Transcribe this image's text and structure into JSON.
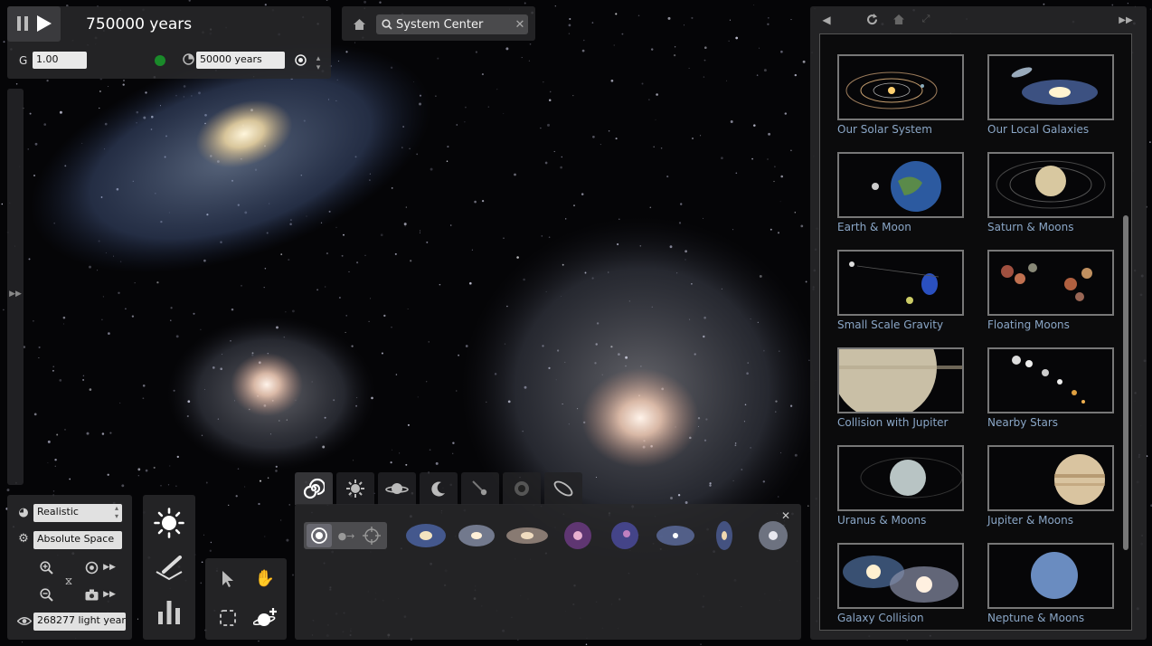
{
  "time": {
    "elapsed": "750000 years",
    "gravity_label": "G",
    "gravity_value": "1.00",
    "step_value": "50000 years"
  },
  "search": {
    "value": "System Center"
  },
  "sidebar": {
    "items": [
      {
        "label": "Our Solar System"
      },
      {
        "label": "Our Local Galaxies"
      },
      {
        "label": "Earth & Moon"
      },
      {
        "label": "Saturn & Moons"
      },
      {
        "label": "Small Scale Gravity"
      },
      {
        "label": "Floating Moons"
      },
      {
        "label": "Collision with Jupiter"
      },
      {
        "label": "Nearby Stars"
      },
      {
        "label": "Uranus & Moons"
      },
      {
        "label": "Jupiter & Moons"
      },
      {
        "label": "Galaxy Collision"
      },
      {
        "label": "Neptune & Moons"
      }
    ]
  },
  "view": {
    "render_mode": "Realistic",
    "space_mode": "Absolute Space",
    "distance": "268277 light year"
  },
  "colors": {
    "panel": "#2a2a2c",
    "link": "#8aa6c6",
    "status_dot": "#1a8a2a"
  }
}
